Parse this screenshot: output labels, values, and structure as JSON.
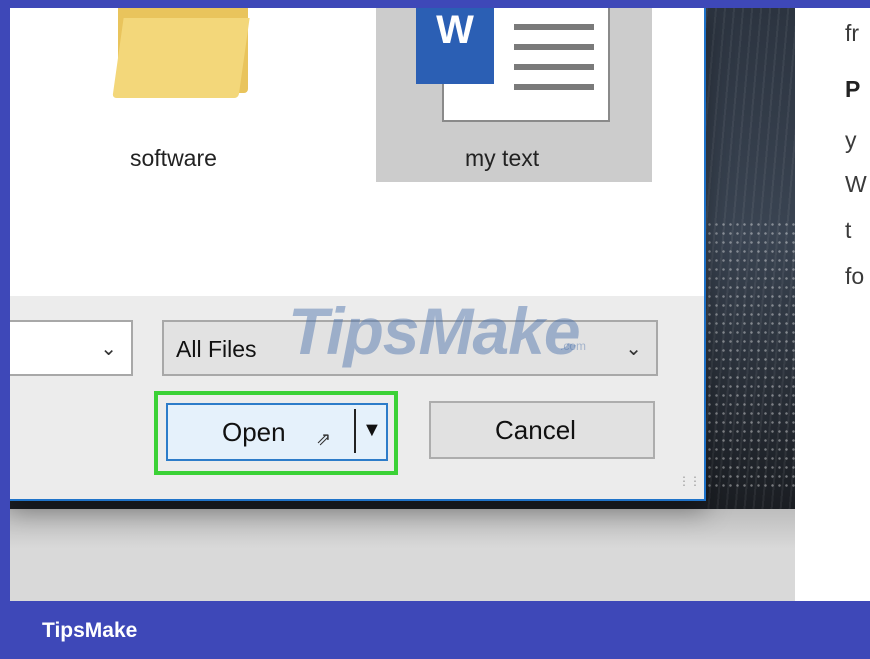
{
  "dialog": {
    "items": [
      {
        "label": "software",
        "icon": "folder-icon"
      },
      {
        "label": "my text",
        "icon": "word-document-icon",
        "badge": "W",
        "selected": true
      }
    ],
    "file_type_filter": {
      "value": "All Files"
    },
    "buttons": {
      "open": "Open",
      "cancel": "Cancel"
    }
  },
  "article": {
    "lines": [
      "fr",
      "P",
      "y",
      "W",
      "t",
      "fo"
    ]
  },
  "watermark": {
    "text": "TipsMake",
    "suffix": ".com"
  },
  "footer": {
    "brand": "TipsMake"
  },
  "colors": {
    "accent": "#3e48b8",
    "highlight": "#3bd136",
    "dialog_border": "#1f73c9",
    "word_blue": "#2b5fb4",
    "folder_yellow": "#f3d77a"
  }
}
